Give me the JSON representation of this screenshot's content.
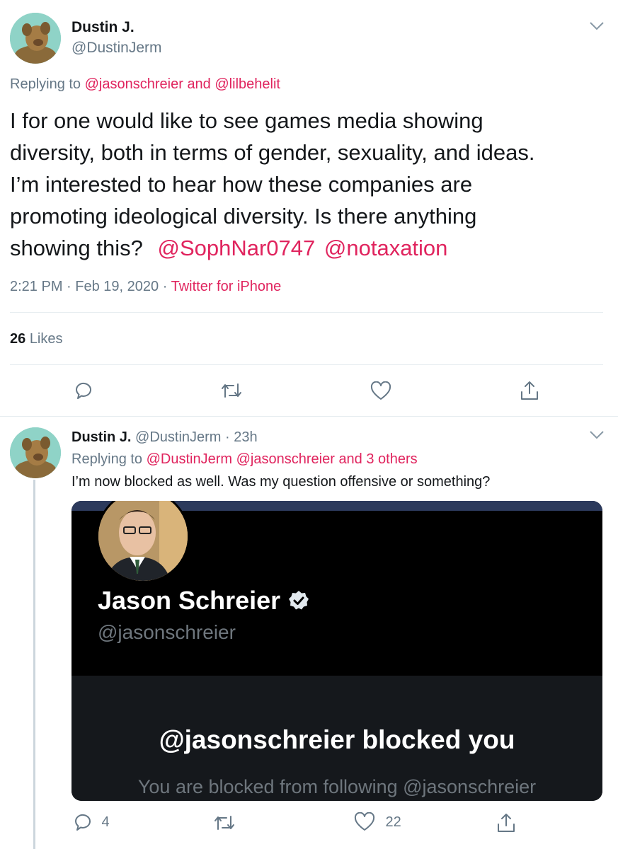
{
  "main_tweet": {
    "display_name": "Dustin J.",
    "handle": "@DustinJerm",
    "replying_prefix": "Replying to",
    "replying_to_1": "@jasonschreier",
    "replying_and": "and",
    "replying_to_2": "@lilbehelit",
    "body_lines": [
      "I for one would like to see games media showing",
      "diversity, both in terms of gender, sexuality, and ideas.",
      "I’m interested to hear how these companies are",
      "promoting ideological diversity.  Is there anything"
    ],
    "body_last_prefix": "showing this?",
    "mention_1": "@SophNar0747",
    "mention_2": "@notaxation",
    "time": "2:21 PM",
    "date": "Feb 19, 2020",
    "source": "Twitter for iPhone",
    "likes_count": "26",
    "likes_label": "Likes"
  },
  "reply_tweet": {
    "display_name": "Dustin J.",
    "handle": "@DustinJerm",
    "age": "23h",
    "replying_prefix": "Replying to",
    "replying_to_1": "@DustinJerm",
    "replying_to_2": "@jasonschreier",
    "replying_others": "and 3 others",
    "body": "I’m now blocked as well. Was my question offensive or something?",
    "screenshot": {
      "name": "Jason Schreier",
      "handle": "@jasonschreier",
      "blocked_title": "@jasonschreier blocked you",
      "blocked_sub": "You are blocked from following @jasonschreier"
    },
    "reply_count": "4",
    "like_count": "22"
  },
  "colors": {
    "accent": "#e0245e",
    "muted": "#657786",
    "divider": "#e6ecf0",
    "thread_line": "#ccd6dd"
  },
  "icons": [
    "chevron-down-icon",
    "reply-icon",
    "retweet-icon",
    "like-icon",
    "share-icon",
    "verified-badge-icon"
  ]
}
